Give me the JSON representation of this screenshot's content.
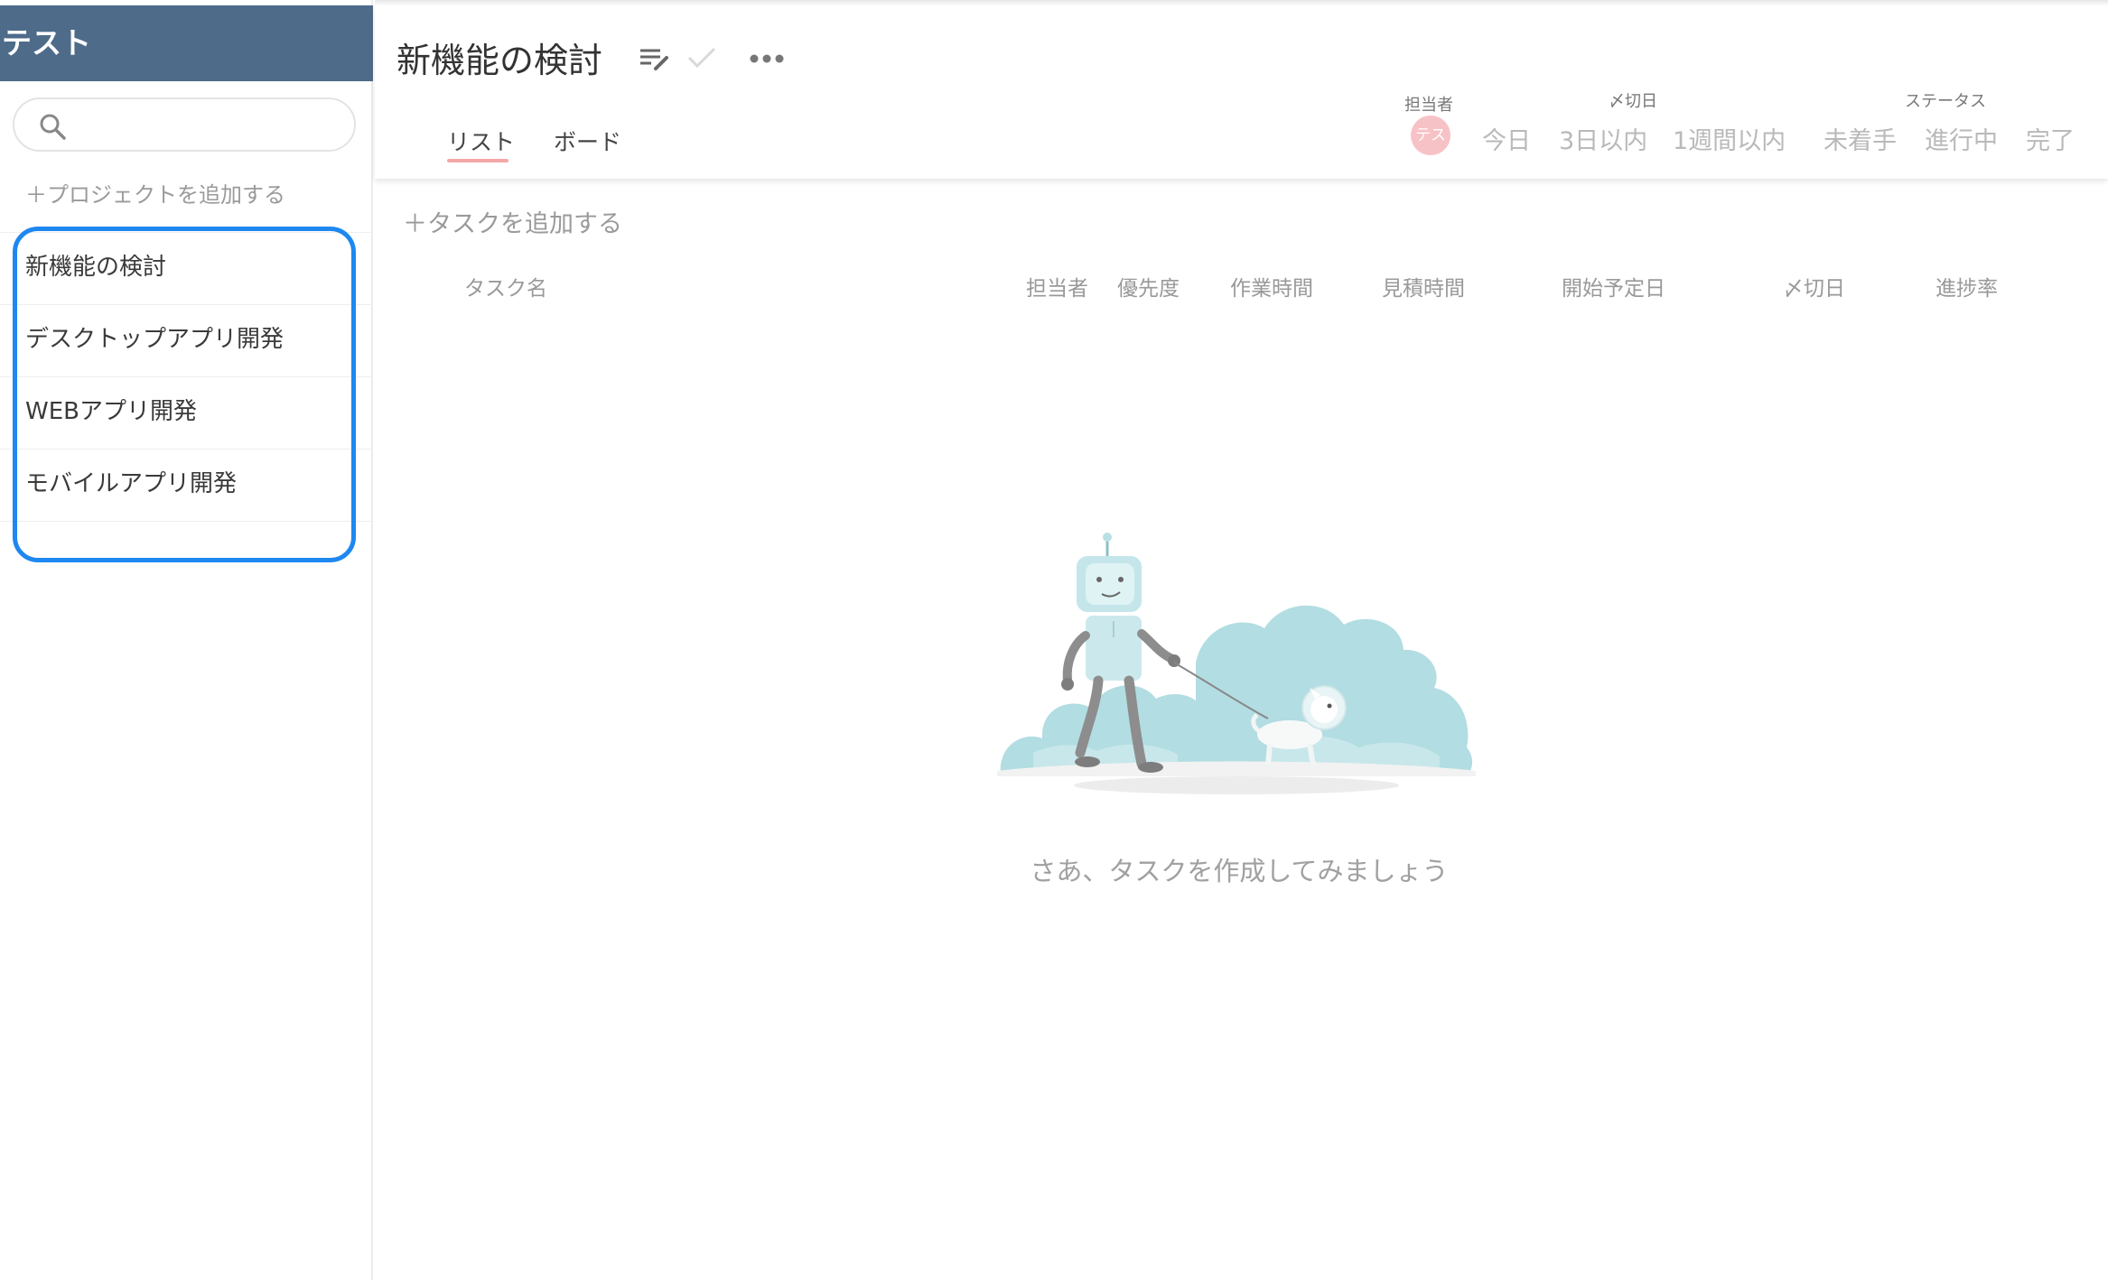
{
  "sidebar": {
    "workspace_name": "テスト",
    "search_placeholder": "",
    "add_project_label": "＋プロジェクトを追加する",
    "projects": [
      {
        "label": "新機能の検討"
      },
      {
        "label": "デスクトップアプリ開発"
      },
      {
        "label": "WEBアプリ開発"
      },
      {
        "label": "モバイルアプリ開発"
      }
    ],
    "highlight_color": "#1e88f0",
    "header_color": "#4e6b8a"
  },
  "header": {
    "title": "新機能の検討",
    "tabs": [
      {
        "label": "リスト",
        "active": true
      },
      {
        "label": "ボード",
        "active": false
      }
    ],
    "icons": [
      "edit-list-icon",
      "check-icon",
      "more-icon"
    ]
  },
  "filters": {
    "assignee": {
      "label": "担当者",
      "chip": "テス"
    },
    "deadline": {
      "label": "〆切日",
      "options": [
        "今日",
        "3日以内",
        "1週間以内"
      ]
    },
    "status": {
      "label": "ステータス",
      "options": [
        "未着手",
        "進行中",
        "完了"
      ]
    }
  },
  "tasks": {
    "add_label": "＋タスクを追加する",
    "columns": [
      "タスク名",
      "担当者",
      "優先度",
      "作業時間",
      "見積時間",
      "開始予定日",
      "〆切日",
      "進捗率"
    ],
    "empty_message": "さあ、タスクを作成してみましょう"
  }
}
